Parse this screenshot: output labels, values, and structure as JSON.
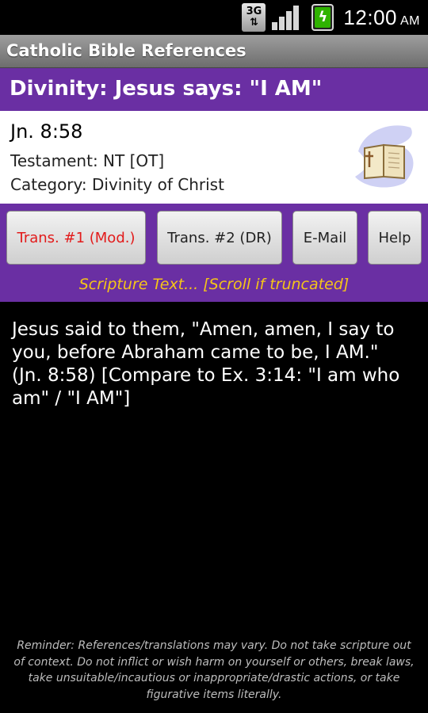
{
  "status_bar": {
    "network_badge_top": "3G",
    "network_badge_bottom": "⇅",
    "time": "12:00",
    "ampm": "AM"
  },
  "app": {
    "title": "Catholic Bible References"
  },
  "reference": {
    "heading": "Divinity: Jesus says: \"I AM\"",
    "verse": "Jn. 8:58",
    "testament": "Testament: NT [OT]",
    "category": "Category: Divinity of Christ"
  },
  "buttons": {
    "trans1": "Trans. #1 (Mod.)",
    "trans2": "Trans. #2 (DR)",
    "email": "E-Mail",
    "help": "Help"
  },
  "scripture": {
    "label": "Scripture Text... [Scroll if truncated]",
    "text": "Jesus said to them, \"Amen, amen, I say to you, before Abraham came to be, I AM.\" (Jn. 8:58) [Compare to Ex. 3:14: \"I am who am\" / \"I AM\"]"
  },
  "reminder": "Reminder: References/translations may vary. Do not take scripture out of context. Do not inflict or wish harm on yourself or others, break laws, take unsuitable/incautious or inappropriate/drastic actions, or take figurative items literally.",
  "colors": {
    "header_purple": "#6a2fa3",
    "active_button_text": "#e21b1b",
    "label_yellow": "#f5c518",
    "battery_green": "#2fb300"
  },
  "icons": [
    "network-3g-icon",
    "signal-strength-icon",
    "battery-charging-icon",
    "open-bible-icon"
  ]
}
